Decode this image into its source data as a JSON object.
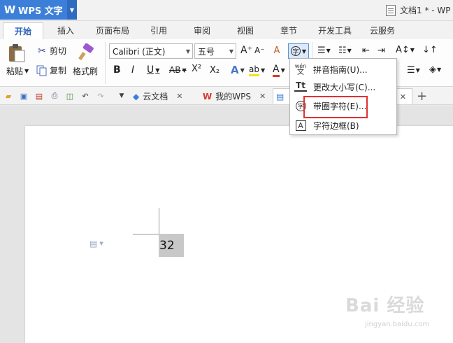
{
  "app": {
    "name": "WPS 文字",
    "logo": "W",
    "doc_title": "文档1 * - WP"
  },
  "tabs": [
    "开始",
    "插入",
    "页面布局",
    "引用",
    "审阅",
    "视图",
    "章节",
    "开发工具",
    "云服务"
  ],
  "ribbon": {
    "paste": "粘贴",
    "cut": "剪切",
    "copy": "复制",
    "format_painter": "格式刷",
    "font_name": "Calibri (正文)",
    "font_size": "五号",
    "grow_font": "A⁺",
    "shrink_font": "A⁻",
    "bold": "B",
    "italic": "I",
    "underline": "U",
    "strikethrough": "AB",
    "superscript": "X²",
    "subscript": "X₂",
    "text_effect": "A",
    "highlight": "ab",
    "font_color": "A",
    "char_tools_icon": "字"
  },
  "quickbar": {
    "tabs": [
      {
        "label": "云文档",
        "closable": true
      },
      {
        "label": "我的WPS",
        "closable": true
      }
    ],
    "add": "+"
  },
  "document": {
    "text": "32"
  },
  "menu": {
    "items": [
      {
        "label": "拼音指南(U)...",
        "icon": "wén"
      },
      {
        "label": "更改大小写(C)...",
        "icon": "Tt"
      },
      {
        "label": "带圈字符(E)...",
        "icon": "字"
      },
      {
        "label": "字符边框(B)",
        "icon": "A"
      }
    ]
  },
  "watermark": {
    "main": "Bai 经验",
    "sub": "jingyan.baidu.com"
  },
  "colors": {
    "accent": "#3c7fd8",
    "highlight_border": "#e03232",
    "selection": "#c8c8c8"
  }
}
